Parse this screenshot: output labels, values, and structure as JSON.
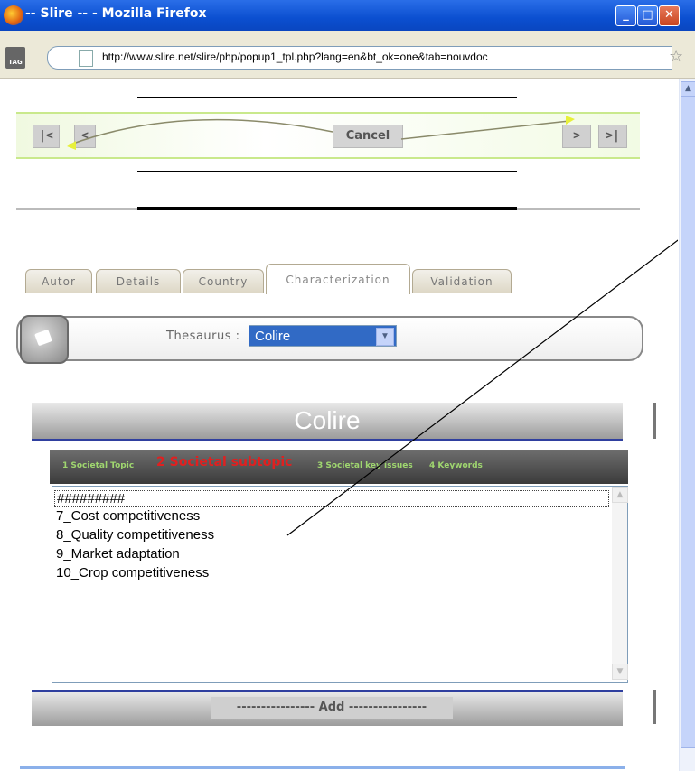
{
  "window": {
    "title": "-- Slire -- - Mozilla Firefox",
    "min_btn": "_",
    "max_btn": "□",
    "close_btn": "✕"
  },
  "addressbar": {
    "tag_label": "TAG",
    "url": "http://www.slire.net/slire/php/popup1_tpl.php?lang=en&bt_ok=one&tab=nouvdoc"
  },
  "nav": {
    "first": "|<",
    "prev": "<",
    "cancel": "Cancel",
    "next": ">",
    "last": ">|"
  },
  "tabs": [
    "Autor",
    "Details",
    "Country",
    "Characterization",
    "Validation"
  ],
  "thesaurus": {
    "label": "Thesaurus :",
    "selected": "Colire"
  },
  "section_title": "Colire",
  "topic_steps": {
    "step1": "1 Societal Topic",
    "step2": "2 Societal subtopic",
    "step3": "3 Societal key issues",
    "step4": "4 Keywords"
  },
  "list_items": [
    "#########",
    "7_Cost competitiveness",
    "8_Quality competitiveness",
    "9_Market adaptation",
    "10_Crop competitiveness"
  ],
  "add_button": "---------------- Add ----------------",
  "colors": {
    "titlebar": "#0b4fd0",
    "select_bg": "#316ac5",
    "topic_active": "#e02020",
    "topic_inactive": "#9fd66f",
    "accent_line": "#2f3f9f"
  }
}
